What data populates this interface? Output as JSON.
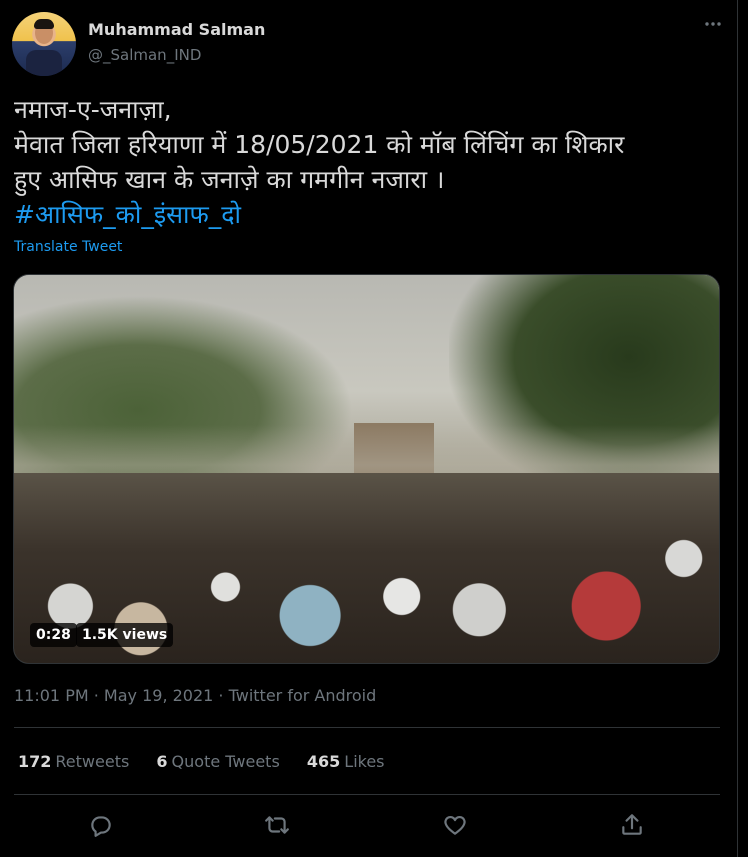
{
  "user": {
    "name": "Muhammad Salman",
    "handle": "@_Salman_IND"
  },
  "tweet": {
    "lines": [
      "नमाज-ए-जनाज़ा,",
      "मेवात जिला हरियाणा में 18/05/2021 को मॉब लिंचिंग का शिकार",
      "हुए आसिफ खान के जनाज़े का गमगीन नजारा ।"
    ],
    "hashtag": "#आसिफ_को_इंसाफ_दो",
    "translate_label": "Translate Tweet"
  },
  "video": {
    "duration": "0:28",
    "views": "1.5K views"
  },
  "meta": {
    "time": "11:01 PM",
    "separator1": " · ",
    "date": "May 19, 2021",
    "separator2": " · ",
    "source": "Twitter for Android"
  },
  "stats": {
    "retweets_count": "172",
    "retweets_label": "Retweets",
    "quotes_count": "6",
    "quotes_label": "Quote Tweets",
    "likes_count": "465",
    "likes_label": "Likes"
  },
  "icons": {
    "more": "more-horizontal-icon",
    "reply": "reply-icon",
    "retweet": "retweet-icon",
    "like": "heart-icon",
    "share": "share-icon"
  },
  "colors": {
    "background": "#000000",
    "text": "#d9d9d9",
    "muted": "#6e767d",
    "accent": "#1d9bf0",
    "divider": "#2f3336"
  }
}
